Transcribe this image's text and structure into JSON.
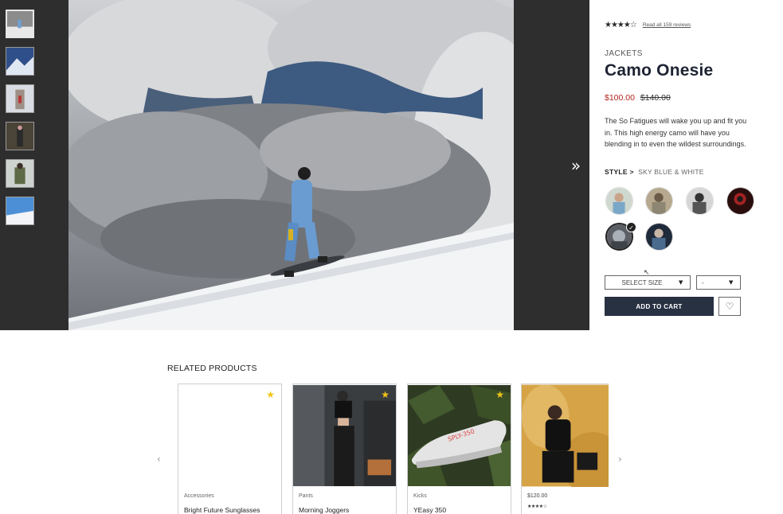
{
  "gallery": {
    "thumbnails": [
      {
        "name": "thumb-snowboarder-cloud"
      },
      {
        "name": "thumb-mountain-blue"
      },
      {
        "name": "thumb-snowy-door"
      },
      {
        "name": "thumb-person-forest"
      },
      {
        "name": "thumb-person-green-jacket"
      },
      {
        "name": "thumb-blue-sky"
      }
    ],
    "next_icon": "chevron-double-right"
  },
  "product": {
    "stars": "★★★★☆",
    "reviews_link": "Read all 159 reviews",
    "category": "JACKETS",
    "title": "Camo Onesie",
    "sale_price": "$100.00",
    "original_price": "$140.00",
    "description": "The So Fatigues will wake you up and fit you in. This high energy camo will have you blending in to even the wildest surroundings.",
    "style_label": "STYLE >",
    "style_value": "SKY BLUE & WHITE",
    "size_select": "SELECT SIZE",
    "qty_select": "-",
    "add_to_cart": "ADD TO CART",
    "check_icon": "✓",
    "caret": "▼",
    "heart": "♡"
  },
  "related": {
    "title": "RELATED PRODUCTS",
    "prev": "‹",
    "next": "›",
    "products": [
      {
        "category": "Accessories",
        "name": "Bright Future Sunglasses",
        "favorite": true
      },
      {
        "category": "Pants",
        "name": "Morning Joggers",
        "favorite": true
      },
      {
        "category": "Kicks",
        "name": "YEasy 350",
        "favorite": true
      },
      {
        "price": "$120.00",
        "stars": "★★★★☆",
        "favorite": false
      }
    ]
  },
  "colors": {
    "dark_panel": "#2e2e2e",
    "button": "#273142",
    "sale": "#b3261e",
    "star_fav": "#f0c419"
  }
}
